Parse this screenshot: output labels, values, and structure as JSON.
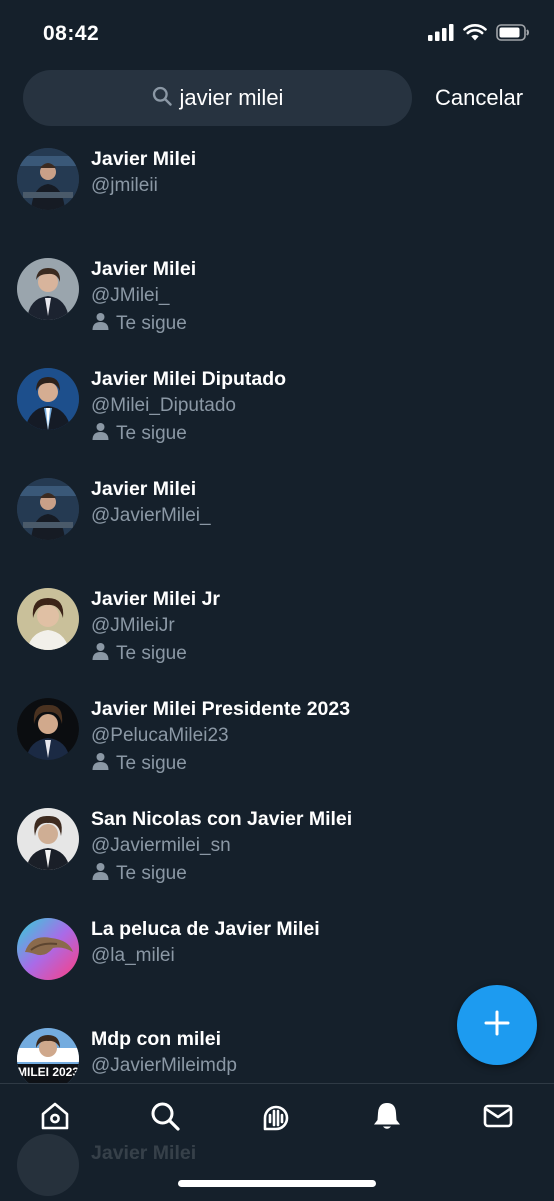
{
  "status": {
    "time": "08:42"
  },
  "search": {
    "query": "javier milei",
    "cancel_label": "Cancelar"
  },
  "results": [
    {
      "name": "Javier Milei",
      "handle": "@jmileii",
      "follows": ""
    },
    {
      "name": "Javier Milei",
      "handle": "@JMilei_",
      "follows": "Te sigue"
    },
    {
      "name": "Javier Milei Diputado",
      "handle": "@Milei_Diputado",
      "follows": "Te sigue"
    },
    {
      "name": "Javier Milei",
      "handle": "@JavierMilei_",
      "follows": ""
    },
    {
      "name": "Javier Milei Jr",
      "handle": "@JMileiJr",
      "follows": "Te sigue"
    },
    {
      "name": "Javier Milei Presidente 2023",
      "handle": "@PelucaMilei23",
      "follows": "Te sigue"
    },
    {
      "name": "San Nicolas con Javier Milei",
      "handle": "@Javiermilei_sn",
      "follows": "Te sigue"
    },
    {
      "name": "La peluca de Javier Milei",
      "handle": "@la_milei",
      "follows": ""
    },
    {
      "name": "Mdp con milei",
      "handle": "@JavierMileimdp",
      "follows": "",
      "avatar_text": "MILEI 2023"
    }
  ],
  "ghost_row": {
    "name": "Javier Milei"
  },
  "colors": {
    "background": "#15202b",
    "accent": "#1d9bf0",
    "secondary_text": "#8b98a5",
    "search_bg": "#273340"
  },
  "tabs": [
    "home-icon",
    "search-icon",
    "spaces-icon",
    "notifications-icon",
    "messages-icon"
  ]
}
